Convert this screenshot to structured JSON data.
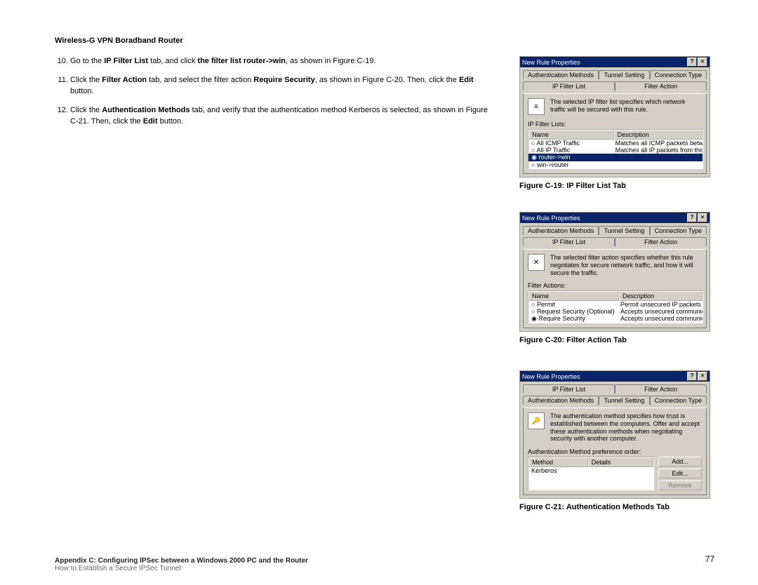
{
  "header": {
    "title": "Wireless-G VPN Boradband Router"
  },
  "steps": {
    "s10a": "Go to the ",
    "s10b": "IP Filter List",
    "s10c": " tab, and click ",
    "s10d": "the filter list router->win",
    "s10e": ", as shown in Figure C-19.",
    "s11a": "Click the ",
    "s11b": "Filter Action",
    "s11c": " tab, and select the filter action ",
    "s11d": "Require Security",
    "s11e": ", as shown in Figure C-20. Then, click the ",
    "s11f": "Edit",
    "s11g": " button.",
    "s12a": "Click the ",
    "s12b": "Authentication Methods",
    "s12c": " tab, and verify that the authentication method Kerberos is selected, as shown in Figure C-21. Then, click the ",
    "s12d": "Edit",
    "s12e": " button."
  },
  "figures": {
    "c19": {
      "caption": "Figure C-19: IP Filter List Tab",
      "dialog_title": "New Rule Properties",
      "tabs_back": [
        "Authentication Methods",
        "Tunnel Setting",
        "Connection Type"
      ],
      "tabs_front": [
        "IP Filter List",
        "Filter Action"
      ],
      "desc": "The selected IP filter list specifies which network traffic will be secured with this rule.",
      "list_label": "IP Filter Lists:",
      "cols": [
        "Name",
        "Description"
      ],
      "rows": [
        {
          "name": "All ICMP Traffic",
          "desc": "Matches all ICMP packets betw...",
          "sel": false
        },
        {
          "name": "All IP Traffic",
          "desc": "Matches all IP packets from this ...",
          "sel": false
        },
        {
          "name": "router->win",
          "desc": "",
          "sel": true
        },
        {
          "name": "win->router",
          "desc": "",
          "sel": false
        }
      ]
    },
    "c20": {
      "caption": "Figure C-20: Filter Action Tab",
      "dialog_title": "New Rule Properties",
      "tabs_back": [
        "Authentication Methods",
        "Tunnel Setting",
        "Connection Type"
      ],
      "tabs_front": [
        "IP Filter List",
        "Filter Action"
      ],
      "desc": "The selected filter action specifies whether this rule negotiates for secure network traffic, and how it will secure the traffic.",
      "list_label": "Filter Actions:",
      "cols": [
        "Name",
        "Description"
      ],
      "rows": [
        {
          "name": "Permit",
          "desc": "Permit unsecured IP packets to ...",
          "sel": false
        },
        {
          "name": "Request Security (Optional)",
          "desc": "Accepts unsecured communicat...",
          "sel": false
        },
        {
          "name": "Require Security",
          "desc": "Accepts unsecured communicat...",
          "sel": true
        }
      ]
    },
    "c21": {
      "caption": "Figure C-21: Authentication Methods Tab",
      "dialog_title": "New Rule Properties",
      "tabs_back": [
        "IP Filter List",
        "Filter Action"
      ],
      "tabs_front": [
        "Authentication Methods",
        "Tunnel Setting",
        "Connection Type"
      ],
      "desc": "The authentication method specifies how trust is established between the computers. Offer and accept these authentication methods when negotiating security with another computer.",
      "list_label": "Authentication Method preference order:",
      "cols": [
        "Method",
        "Details"
      ],
      "rows": [
        {
          "name": "Kerberos",
          "desc": ""
        }
      ],
      "buttons": [
        "Add...",
        "Edit...",
        "Remove"
      ]
    }
  },
  "footer": {
    "line1": "Appendix C: Configuring IPSec between a Windows 2000 PC and the Router",
    "line2": "How to Establish a Secure IPSec Tunnel",
    "page": "77"
  },
  "icons": {
    "help": "?",
    "close": "×",
    "list_icon": "≡",
    "tool_icon": "✕",
    "key_icon": "🔑"
  }
}
